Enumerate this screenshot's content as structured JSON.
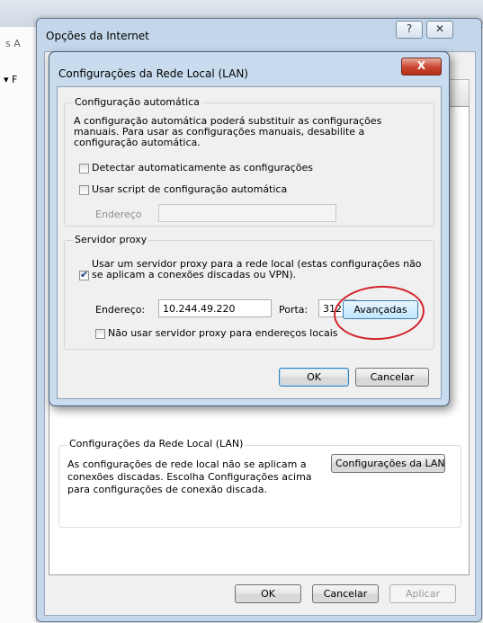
{
  "background": {
    "left_menu_text_1": "s A",
    "left_menu_text_2": "▾ F"
  },
  "internet_options": {
    "title": "Opções da Internet",
    "help_button": "?",
    "close_button": "✕",
    "lan_section": {
      "group_title": "Configurações da Rede Local (LAN)",
      "description_line1": "As configurações de rede local não se aplicam a",
      "description_line2": "conexões discadas. Escolha Configurações acima",
      "description_line3": "para configurações de conexão discada.",
      "lan_settings_button": "Configurações da LAN"
    },
    "buttons": {
      "ok": "OK",
      "cancel": "Cancelar",
      "apply": "Aplicar"
    }
  },
  "lan_dialog": {
    "title": "Configurações da Rede Local (LAN)",
    "close_button": "X",
    "auto_config": {
      "legend": "Configuração automática",
      "description_line1": "A configuração automática poderá substituir as configurações",
      "description_line2": "manuais. Para usar as configurações manuais, desabilite a",
      "description_line3": "configuração automática.",
      "detect_label": "Detectar automaticamente as configurações",
      "detect_checked": false,
      "script_label": "Usar script de configuração automática",
      "script_checked": false,
      "address_label": "Endereço",
      "address_value": ""
    },
    "proxy": {
      "legend": "Servidor proxy",
      "use_proxy_line1": "Usar um servidor proxy para a rede local (estas configurações não",
      "use_proxy_line2": "se aplicam a conexões discadas ou VPN).",
      "use_proxy_checked": true,
      "address_label": "Endereço:",
      "address_value": "10.244.49.220",
      "port_label": "Porta:",
      "port_value": "3128",
      "advanced_button": "Avançadas",
      "bypass_label": "Não usar servidor proxy para endereços locais",
      "bypass_checked": false
    },
    "buttons": {
      "ok": "OK",
      "cancel": "Cancelar"
    }
  },
  "colors": {
    "highlight_circle": "#d2232a",
    "dialog_frame": "#c9dcef"
  }
}
